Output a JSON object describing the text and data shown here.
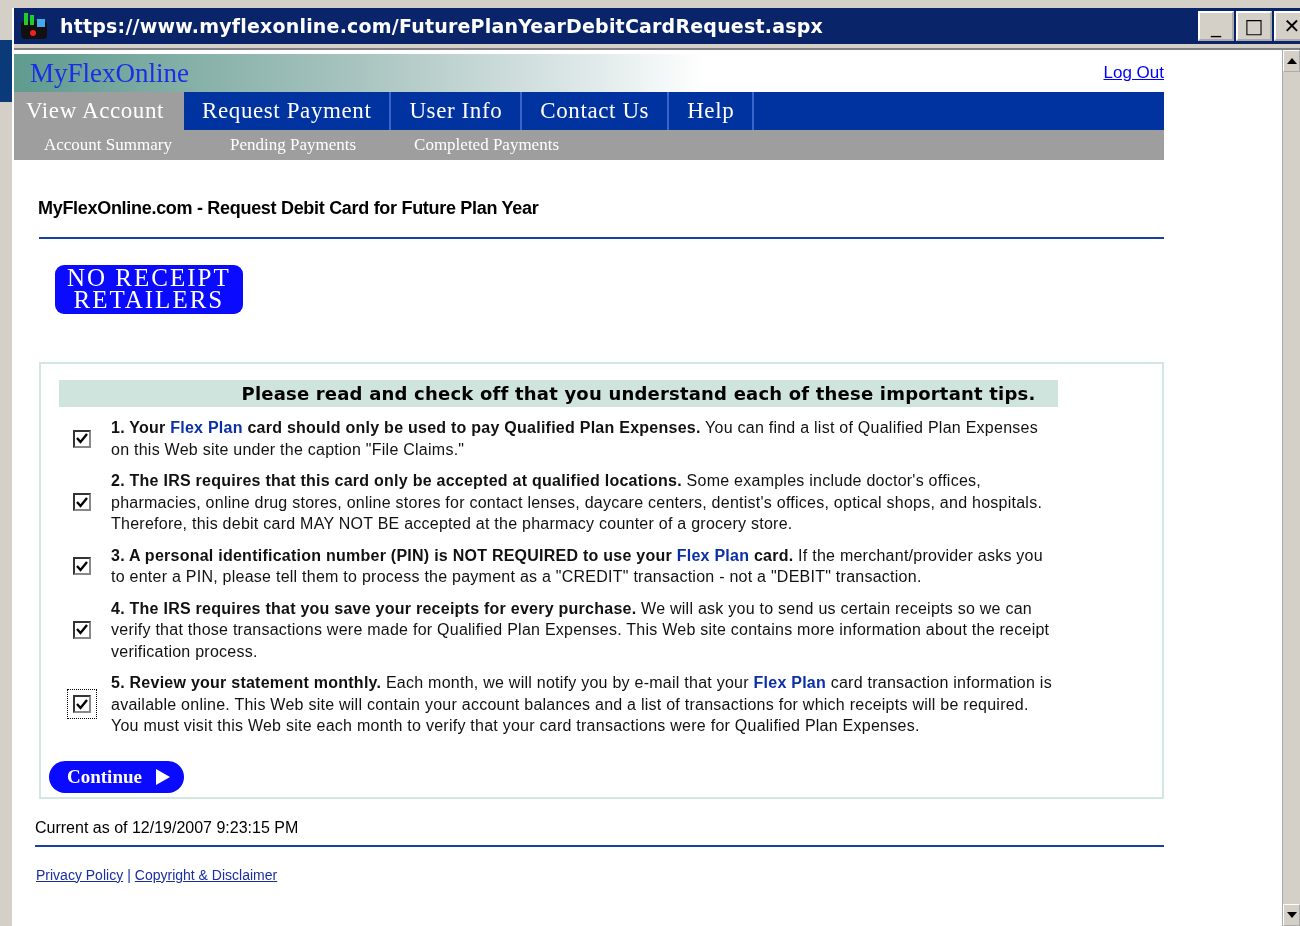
{
  "window": {
    "title": "https://www.myflexonline.com/FuturePlanYearDebitCardRequest.aspx",
    "controls": [
      "_",
      "□",
      "✕"
    ]
  },
  "header": {
    "logo": "MyFlexOnline",
    "logout": "Log Out"
  },
  "tabs": [
    {
      "label": "View Account",
      "selected": true
    },
    {
      "label": "Request Payment",
      "selected": false
    },
    {
      "label": "User Info",
      "selected": false
    },
    {
      "label": "Contact Us",
      "selected": false
    },
    {
      "label": "Help",
      "selected": false
    }
  ],
  "subtabs": [
    "Account Summary",
    "Pending Payments",
    "Completed Payments"
  ],
  "page_title": "MyFlexOnline.com - Request Debit Card for Future Plan Year",
  "badge": [
    "NO RECEIPT",
    "RETAILERS"
  ],
  "tips_heading": "Please read and check off that you understand each of these important tips.",
  "tips": [
    {
      "checked": true,
      "focused": false,
      "segments": [
        {
          "kind": "bold",
          "text": "1. Your "
        },
        {
          "kind": "brand",
          "text": "Flex Plan"
        },
        {
          "kind": "bold",
          "text": " card should only be used to pay Qualified Plan Expenses."
        },
        {
          "kind": "plain",
          "text": " You can find a list of Qualified Plan Expenses on this Web site under the caption \"File Claims.\""
        }
      ]
    },
    {
      "checked": true,
      "focused": false,
      "segments": [
        {
          "kind": "bold",
          "text": "2. The IRS requires that this card only be accepted at qualified locations."
        },
        {
          "kind": "plain",
          "text": " Some examples include doctor's offices, pharmacies, online drug stores, online stores for contact lenses, daycare centers, dentist's offices, optical shops, and hospitals. Therefore, this debit card MAY NOT BE accepted at the pharmacy counter of a grocery store."
        }
      ]
    },
    {
      "checked": true,
      "focused": false,
      "segments": [
        {
          "kind": "bold",
          "text": "3. A personal identification number (PIN) is NOT REQUIRED to use your "
        },
        {
          "kind": "brand",
          "text": "Flex Plan"
        },
        {
          "kind": "bold",
          "text": " card."
        },
        {
          "kind": "plain",
          "text": " If the merchant/provider asks you to enter a PIN, please tell them to process the payment as a \"CREDIT\" transaction - not a \"DEBIT\" transaction."
        }
      ]
    },
    {
      "checked": true,
      "focused": false,
      "segments": [
        {
          "kind": "bold",
          "text": "4. The IRS requires that you save your receipts for every purchase."
        },
        {
          "kind": "plain",
          "text": " We will ask you to send us certain receipts so we can verify that those transactions were made for Qualified Plan Expenses. This Web site contains more information about the receipt verification process."
        }
      ]
    },
    {
      "checked": true,
      "focused": true,
      "segments": [
        {
          "kind": "bold",
          "text": "5. Review your statement monthly."
        },
        {
          "kind": "plain",
          "text": " Each month, we will notify you by e-mail that your "
        },
        {
          "kind": "brand",
          "text": "Flex Plan"
        },
        {
          "kind": "plain",
          "text": " card transaction information is available online. This Web site will contain your account balances and a list of transactions for which receipts will be required. You must visit this Web site each month to verify that your card transactions were for Qualified Plan Expenses."
        }
      ]
    }
  ],
  "continue_button": "Continue",
  "timestamp": "Current as of 12/19/2007 9:23:15 PM",
  "footer_links": [
    "Privacy Policy",
    "|",
    "Copyright & Disclaimer"
  ]
}
